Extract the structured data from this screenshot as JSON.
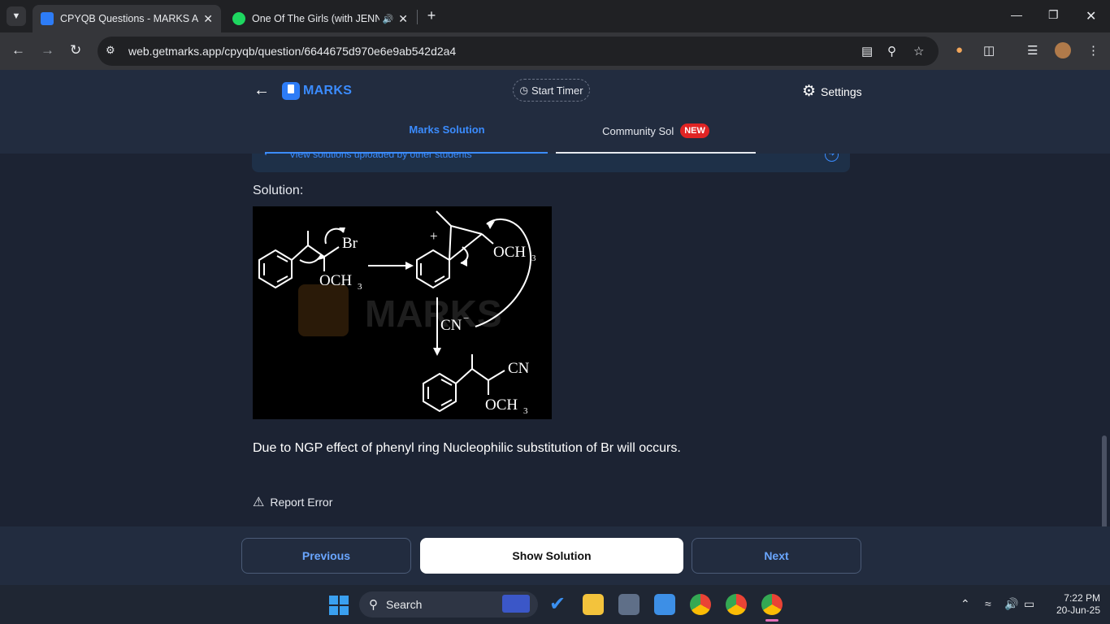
{
  "browser": {
    "tabs": [
      {
        "title": "CPYQB Questions - MARKS App",
        "active": true
      },
      {
        "title": "One Of The Girls (with JENNIE",
        "active": false,
        "audio": true
      }
    ],
    "url": "web.getmarks.app/cpyqb/question/6644675d970e6e9ab542d2a4"
  },
  "header": {
    "logo_text": "MARKS",
    "timer_label": "Start Timer",
    "settings_label": "Settings"
  },
  "solution_tabs": {
    "marks": "Marks Solution",
    "community": "Community Sol",
    "new_badge": "NEW"
  },
  "banner": {
    "text": "View solutions uploaded by other students"
  },
  "solution": {
    "label": "Solution:",
    "figure": {
      "reagent1": "Br",
      "group1": "OCH",
      "sub3": "3",
      "plus": "+",
      "group2": "OCH",
      "nucleophile": "CN",
      "minus": "−",
      "product_cn": "CN",
      "product_och": "OCH",
      "watermark": "MARKS"
    },
    "explanation": "Due to NGP effect of phenyl ring Nucleophilic substitution of Br will occurs.",
    "report_label": "Report Error"
  },
  "footer": {
    "previous": "Previous",
    "show_solution": "Show Solution",
    "next": "Next"
  },
  "taskbar": {
    "search_label": "Search",
    "time": "7:22 PM",
    "date": "20-Jun-25"
  },
  "colors": {
    "accent": "#3b8cff",
    "background": "#1c2333",
    "header": "#222c3f",
    "badge": "#e02424"
  }
}
